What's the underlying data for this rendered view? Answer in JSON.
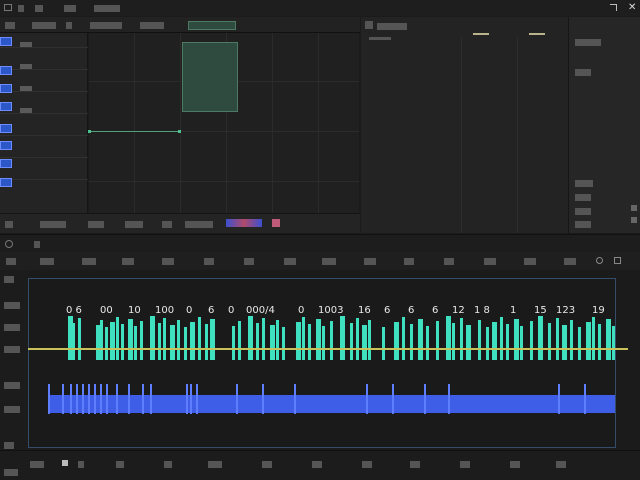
{
  "timeline": {
    "numbers": [
      "0 6",
      "00",
      "10",
      "100",
      "0",
      "6",
      "0",
      "000/4",
      "0",
      "1003",
      "16",
      "6",
      "6",
      "6",
      "12",
      "1 8",
      "1",
      "15",
      "123",
      "19"
    ]
  },
  "colors": {
    "accent_green": "#3fe0c0",
    "accent_blue": "#5f7dff",
    "playhead": "#c9c25b",
    "background": "#1b1b1b"
  }
}
